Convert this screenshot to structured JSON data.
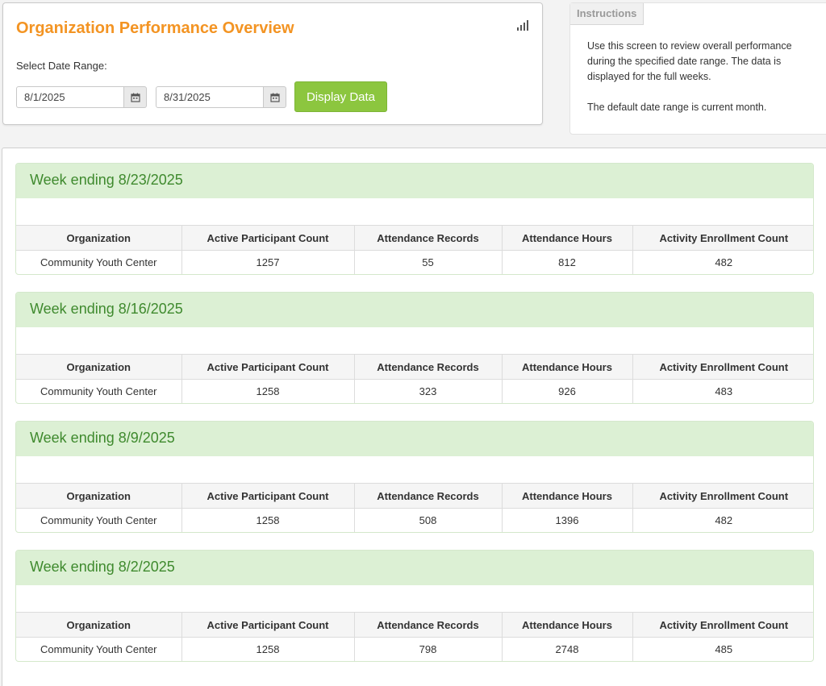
{
  "header": {
    "title": "Organization Performance Overview",
    "date_range_label": "Select Date Range:",
    "start_date": "8/1/2025",
    "end_date": "8/31/2025",
    "display_button": "Display Data"
  },
  "instructions": {
    "tab_label": "Instructions",
    "paragraph1": "Use this screen to review overall performance during the specified date range. The data is displayed for the full weeks.",
    "paragraph2": "The default date range is current month."
  },
  "columns": [
    "Organization",
    "Active Participant Count",
    "Attendance Records",
    "Attendance Hours",
    "Activity Enrollment Count"
  ],
  "weeks": [
    {
      "title": "Week ending 8/23/2025",
      "row": [
        "Community Youth Center",
        "1257",
        "55",
        "812",
        "482"
      ]
    },
    {
      "title": "Week ending 8/16/2025",
      "row": [
        "Community Youth Center",
        "1258",
        "323",
        "926",
        "483"
      ]
    },
    {
      "title": "Week ending 8/9/2025",
      "row": [
        "Community Youth Center",
        "1258",
        "508",
        "1396",
        "482"
      ]
    },
    {
      "title": "Week ending 8/2/2025",
      "row": [
        "Community Youth Center",
        "1258",
        "798",
        "2748",
        "485"
      ]
    }
  ],
  "colors": {
    "title_orange": "#f39423",
    "button_green": "#8cc63f",
    "week_header_bg": "#dcf0d4",
    "week_header_text": "#3f8a2e"
  },
  "icons": {
    "status": "signal-icon",
    "calendar": "calendar-icon"
  }
}
